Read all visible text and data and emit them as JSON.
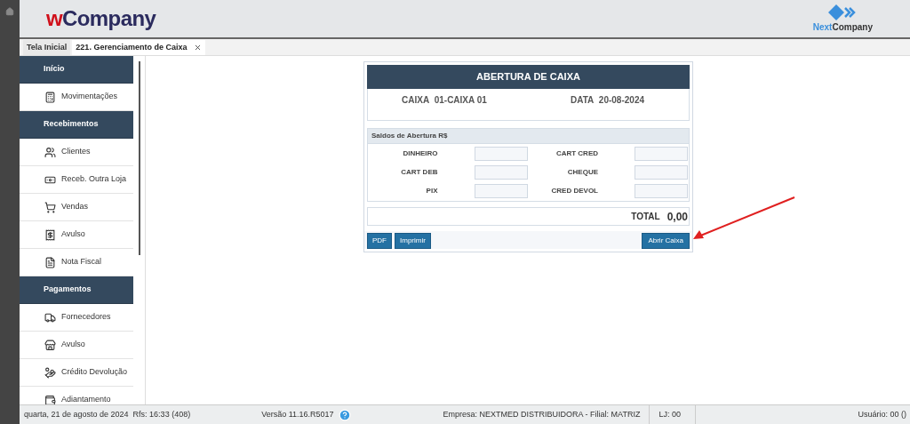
{
  "logo": {
    "prefix": "w",
    "name": "Company"
  },
  "brand": {
    "prefix": "Next",
    "name": "Company"
  },
  "tabs": [
    {
      "label": "Tela Inicial",
      "selected": false,
      "closable": false
    },
    {
      "label": "221. Gerenciamento de Caixa",
      "selected": true,
      "closable": true
    }
  ],
  "sidebar": {
    "items": [
      {
        "kind": "header",
        "label": "Início"
      },
      {
        "kind": "item",
        "label": "Movimentações"
      },
      {
        "kind": "header",
        "label": "Recebimentos"
      },
      {
        "kind": "item",
        "label": "Clientes"
      },
      {
        "kind": "item",
        "label": "Receb. Outra Loja"
      },
      {
        "kind": "item",
        "label": "Vendas"
      },
      {
        "kind": "item",
        "label": "Avulso"
      },
      {
        "kind": "item",
        "label": "Nota Fiscal"
      },
      {
        "kind": "header",
        "label": "Pagamentos"
      },
      {
        "kind": "item",
        "label": "Fornecedores"
      },
      {
        "kind": "item",
        "label": "Avulso"
      },
      {
        "kind": "item",
        "label": "Crédito Devolução"
      },
      {
        "kind": "item",
        "label": "Adiantamento"
      }
    ]
  },
  "form": {
    "title": "ABERTURA DE CAIXA",
    "info": [
      {
        "label": "CAIXA",
        "value": "01-CAIXA 01"
      },
      {
        "label": "DATA",
        "value": "20-08-2024"
      }
    ],
    "section": "Saldos de Abertura R$",
    "fields": [
      {
        "label": "DINHEIRO"
      },
      {
        "label": "CART CRED"
      },
      {
        "label": "CART DEB"
      },
      {
        "label": "CHEQUE"
      },
      {
        "label": "PIX"
      },
      {
        "label": "CRED DEVOL"
      }
    ],
    "total_label": "TOTAL",
    "total": "0,00",
    "buttons": [
      "PDF",
      "Imprimir"
    ],
    "primary_button": "Abrir Caixa"
  },
  "status_bar": {
    "date": "quarta, 21 de agosto de 2024",
    "refresh": "Rfs: 16:33 (408)",
    "version": "Versão 11.16.R5017",
    "company": "Empresa: NEXTMED DISTRIBUIDORA - Filial: MATRIZ",
    "store": "LJ: 00",
    "user": "Usuário: 00 ()"
  }
}
